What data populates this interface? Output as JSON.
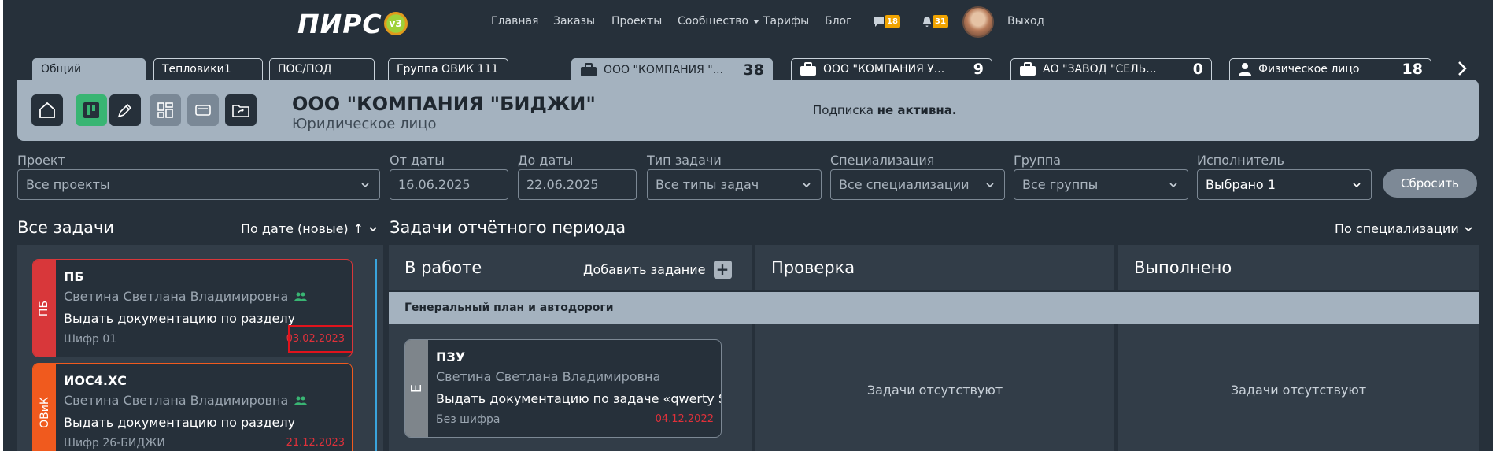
{
  "logo": {
    "text": "ПИРС",
    "version": "v3"
  },
  "nav": {
    "links": [
      "Главная",
      "Заказы",
      "Проекты",
      "Сообщество",
      "Тарифы",
      "Блог"
    ],
    "messages_count": "18",
    "notifications_count": "31",
    "logout": "Выход"
  },
  "tabs": {
    "groups": [
      "Общий",
      "Тепловики1",
      "ПОС/ПОД",
      "Группа ОВИК 111"
    ],
    "companies": [
      {
        "name": "ООО \"КОМПАНИЯ \"...",
        "count": "38"
      },
      {
        "name": "ООО \"КОМПАНИЯ У...",
        "count": "9"
      },
      {
        "name": "АО \"ЗАВОД \"СЕЛЬ...",
        "count": "0"
      },
      {
        "name": "Физическое лицо",
        "count": "18"
      }
    ]
  },
  "company": {
    "name": "ООО \"КОМПАНИЯ \"БИДЖИ\"",
    "type": "Юридическое лицо",
    "subscription_prefix": "Подписка",
    "subscription_status": "не активна."
  },
  "filters": {
    "project": {
      "label": "Проект",
      "value": "Все проекты"
    },
    "date_from": {
      "label": "От даты",
      "value": "16.06.2025"
    },
    "date_to": {
      "label": "До даты",
      "value": "22.06.2025"
    },
    "task_type": {
      "label": "Тип задачи",
      "value": "Все типы задач"
    },
    "specialization": {
      "label": "Специализация",
      "value": "Все специализации"
    },
    "group": {
      "label": "Группа",
      "value": "Все группы"
    },
    "executor": {
      "label": "Исполнитель",
      "value": "Выбрано 1"
    },
    "reset": "Сбросить"
  },
  "all_tasks": {
    "title": "Все задачи",
    "sort": "По дате (новые)",
    "sort_arrow": "↑",
    "items": [
      {
        "stripe": "ПБ",
        "stripe_color": "#d8373a",
        "title": "ПБ",
        "person": "Светина Светлана Владимировна",
        "desc": "Выдать документацию по разделу",
        "code": "Шифр 01",
        "date": "03.02.2023"
      },
      {
        "stripe": "ОВиК",
        "stripe_color": "#f05a1e",
        "title": "ИОС4.ХС",
        "person": "Светина Светлана Владимировна",
        "desc": "Выдать документацию по разделу",
        "code": "Шифр 26-БИДЖИ",
        "date": "21.12.2023"
      }
    ]
  },
  "period": {
    "title": "Задачи отчётного периода",
    "sort": "По специализации",
    "columns": {
      "in_work": "В работе",
      "add_task": "Добавить задание",
      "check": "Проверка",
      "done": "Выполнено"
    },
    "group_name": "Генеральный план и автодороги",
    "task": {
      "stripe": "Е",
      "title": "ПЗУ",
      "person": "Светина Светлана Владимировна",
      "desc": "Выдать документацию по задаче «qwerty S»",
      "code": "Без шифра",
      "date": "04.12.2022"
    },
    "empty": "Задачи отсутствуют"
  },
  "colors": {
    "background": "#26303a",
    "panel": "#323d48",
    "accent_panel": "#a4b2bf",
    "badge": "#f0a300",
    "date_red": "#e0313a",
    "green": "#39b573"
  },
  "icons": [
    "home-icon",
    "kanban-icon",
    "pen-icon",
    "dashboard-icon",
    "tablet-icon",
    "folder-share-icon",
    "chat-icon",
    "bell-icon",
    "briefcase-icon",
    "person-icon",
    "chevron-down-icon",
    "chevron-right-icon",
    "group-users-icon"
  ]
}
